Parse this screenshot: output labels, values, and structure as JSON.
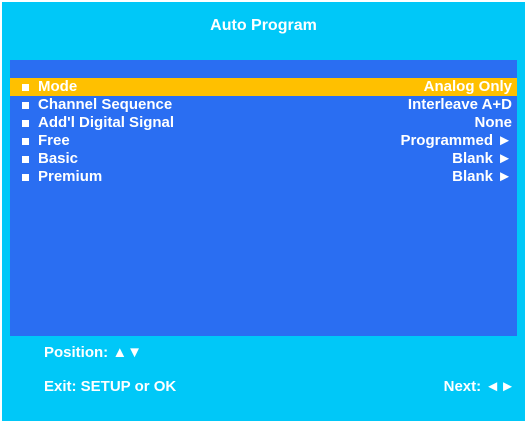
{
  "header": {
    "title": "Auto Program"
  },
  "menu": {
    "items": [
      {
        "label": "Mode",
        "value": "Analog Only",
        "selected": true
      },
      {
        "label": "Channel Sequence",
        "value": "Interleave A+D",
        "selected": false
      },
      {
        "label": "Add'l Digital Signal",
        "value": "None",
        "selected": false
      },
      {
        "label": "Free",
        "value": "Programmed ►",
        "selected": false
      },
      {
        "label": "Basic",
        "value": "Blank ►",
        "selected": false
      },
      {
        "label": "Premium",
        "value": "Blank ►",
        "selected": false
      }
    ]
  },
  "footer": {
    "position": "Position: ▲▼",
    "exit": "Exit: SETUP or OK",
    "next": "Next: ◄►"
  },
  "colors": {
    "outer_background": "#00c8f8",
    "panel_background": "#2a6ef2",
    "highlight": "#ffc000",
    "text": "#ffffff"
  }
}
